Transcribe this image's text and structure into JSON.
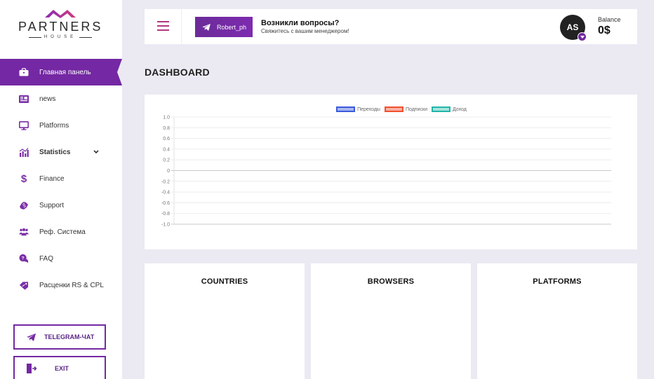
{
  "sidebar": {
    "logo": {
      "brand": "PARTNERS",
      "sub": "HOUSE"
    },
    "items": [
      {
        "label": "Главная панель",
        "icon": "briefcase-icon",
        "active": true
      },
      {
        "label": "news",
        "icon": "newspaper-icon"
      },
      {
        "label": "Platforms",
        "icon": "monitor-icon"
      },
      {
        "label": "Statistics",
        "icon": "chart-icon",
        "expandable": true
      },
      {
        "label": "Finance",
        "icon": "dollar-icon"
      },
      {
        "label": "Support",
        "icon": "handshake-icon"
      },
      {
        "label": "Реф. Система",
        "icon": "users-icon"
      },
      {
        "label": "FAQ",
        "icon": "question-chat-icon"
      },
      {
        "label": "Расценки RS & CPL",
        "icon": "price-tag-icon"
      }
    ],
    "telegram_button": "TELEGRAM-ЧАТ",
    "exit_button": "EXIT"
  },
  "header": {
    "telegram_user": "Robert_ph",
    "question_title": "Возникли вопросы?",
    "question_subtitle": "Свяжитесь с вашим менеджером!",
    "avatar_initials": "AS",
    "balance_label": "Balance",
    "balance_value": "0$"
  },
  "page_title": "DASHBOARD",
  "chart_data": {
    "type": "line",
    "title": "",
    "xlabel": "",
    "ylabel": "",
    "ylim": [
      -1.0,
      1.0
    ],
    "y_ticks": [
      "1.0",
      "0.8",
      "0.6",
      "0.4",
      "0.2",
      "0",
      "-0.2",
      "-0.4",
      "-0.6",
      "-0.8",
      "-1.0"
    ],
    "grid": true,
    "legend_position": "top",
    "x": [],
    "series": [
      {
        "name": "Переходы",
        "values": [],
        "color": "#3b5bdb",
        "fill": "#a9b7f2"
      },
      {
        "name": "Подписки",
        "values": [],
        "color": "#f0502f",
        "fill": "#f8b0a2"
      },
      {
        "name": "Доход",
        "values": [],
        "color": "#22b5a8",
        "fill": "#a5e3dd"
      }
    ]
  },
  "cards": [
    {
      "title": "COUNTRIES"
    },
    {
      "title": "BROWSERS"
    },
    {
      "title": "PLATFORMS"
    }
  ],
  "colors": {
    "accent": "#7428a3",
    "background": "#ebeaf3"
  }
}
